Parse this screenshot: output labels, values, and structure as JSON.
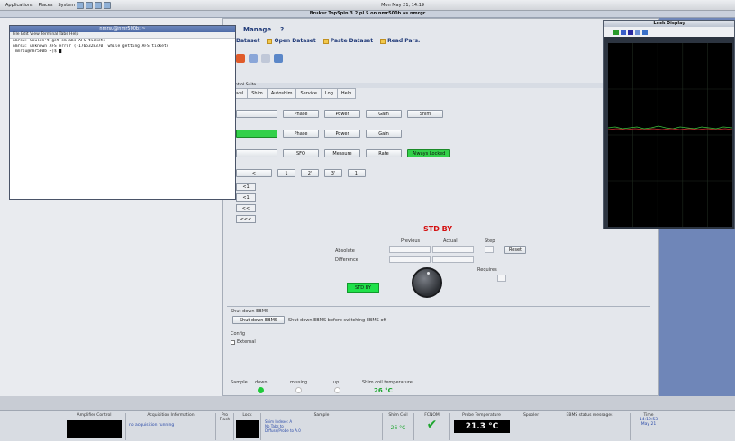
{
  "top_panel": {
    "applications": "Applications",
    "places": "Places",
    "system": "System",
    "clock": "Mon May 21, 14:19"
  },
  "window_title": "Bruker TopSpin 3.2 pl 5 on nmr500b as nmrgr",
  "menus": {
    "manage": "Manage",
    "help": "?"
  },
  "dataset": {
    "dataset": "Dataset",
    "open": "Open Dataset",
    "paste": "Paste Dataset",
    "read": "Read Pars."
  },
  "terminal": {
    "title": "nmrsu@nmr500b: ~",
    "menu": "File  Edit  View  Terminal  Tabs  Help",
    "lines": [
      "nmrsu: Couldn't get sm abs AFS tickets",
      "nmrsu: unknown AFS error (-1765328370) while getting AFS tickets",
      "[nmrsu@nmr500b ~]$ █"
    ]
  },
  "control_title": "Control Suite",
  "tabs": [
    "Level",
    "Shim",
    "Autoshim",
    "Service",
    "Log",
    "Help"
  ],
  "rows": {
    "r1": [
      "",
      "Phase",
      "Power",
      "Gain",
      "Shim"
    ],
    "r2": [
      "",
      "Phase",
      "Power",
      "Gain"
    ],
    "r3": [
      "",
      "SFO",
      "Measure",
      "Rate",
      "Always Locked"
    ],
    "r4": [
      "<",
      "1",
      "2'",
      "3'",
      "1'"
    ]
  },
  "arrows": [
    "<1",
    "<1",
    "<<",
    "<<<"
  ],
  "stdby": {
    "title": "STD BY",
    "previous": "Previous",
    "actual": "Actual",
    "step": "Step",
    "absolute": "Absolute",
    "difference": "Difference",
    "reset": "Reset",
    "requires": "Requires",
    "button": "STD BY"
  },
  "shutdown": {
    "label": "Shut down EBMS",
    "button": "Shut down EBMS",
    "text": "Shut down EBMS before switching EBMS off"
  },
  "config": {
    "label": "Config",
    "external": "External"
  },
  "sample": {
    "sample": "Sample",
    "down": "down",
    "missing": "missing",
    "up": "up",
    "shim_coil": "Shim coil temperature",
    "temp": "26 °C"
  },
  "lock_display": {
    "title": "Lock Display"
  },
  "statusbar": {
    "amp": "Amplifier Control",
    "acq": "Acquisition Information",
    "acq_text": "no acquisition running",
    "pro": "Pro Flash",
    "lock": "Lock",
    "sample": "Sample",
    "shimcoil": "Shim Coil",
    "shimcoil_temp": "26 °C",
    "fcnom": "FCNOM",
    "probe": "Probe Temperature",
    "probe_temp": "21.3 °C",
    "spooler": "Spooler",
    "ebms": "EBMS status messages",
    "time": "Time",
    "time_val": "14:19:53",
    "date": "May 21",
    "sample_text": "Shim Indexe: A\nNo Tabs to\nDiffuse/Probe to A.0"
  },
  "colors": {
    "green": "#33d04a",
    "stdby_red": "#d41010",
    "accent": "#203a78"
  }
}
